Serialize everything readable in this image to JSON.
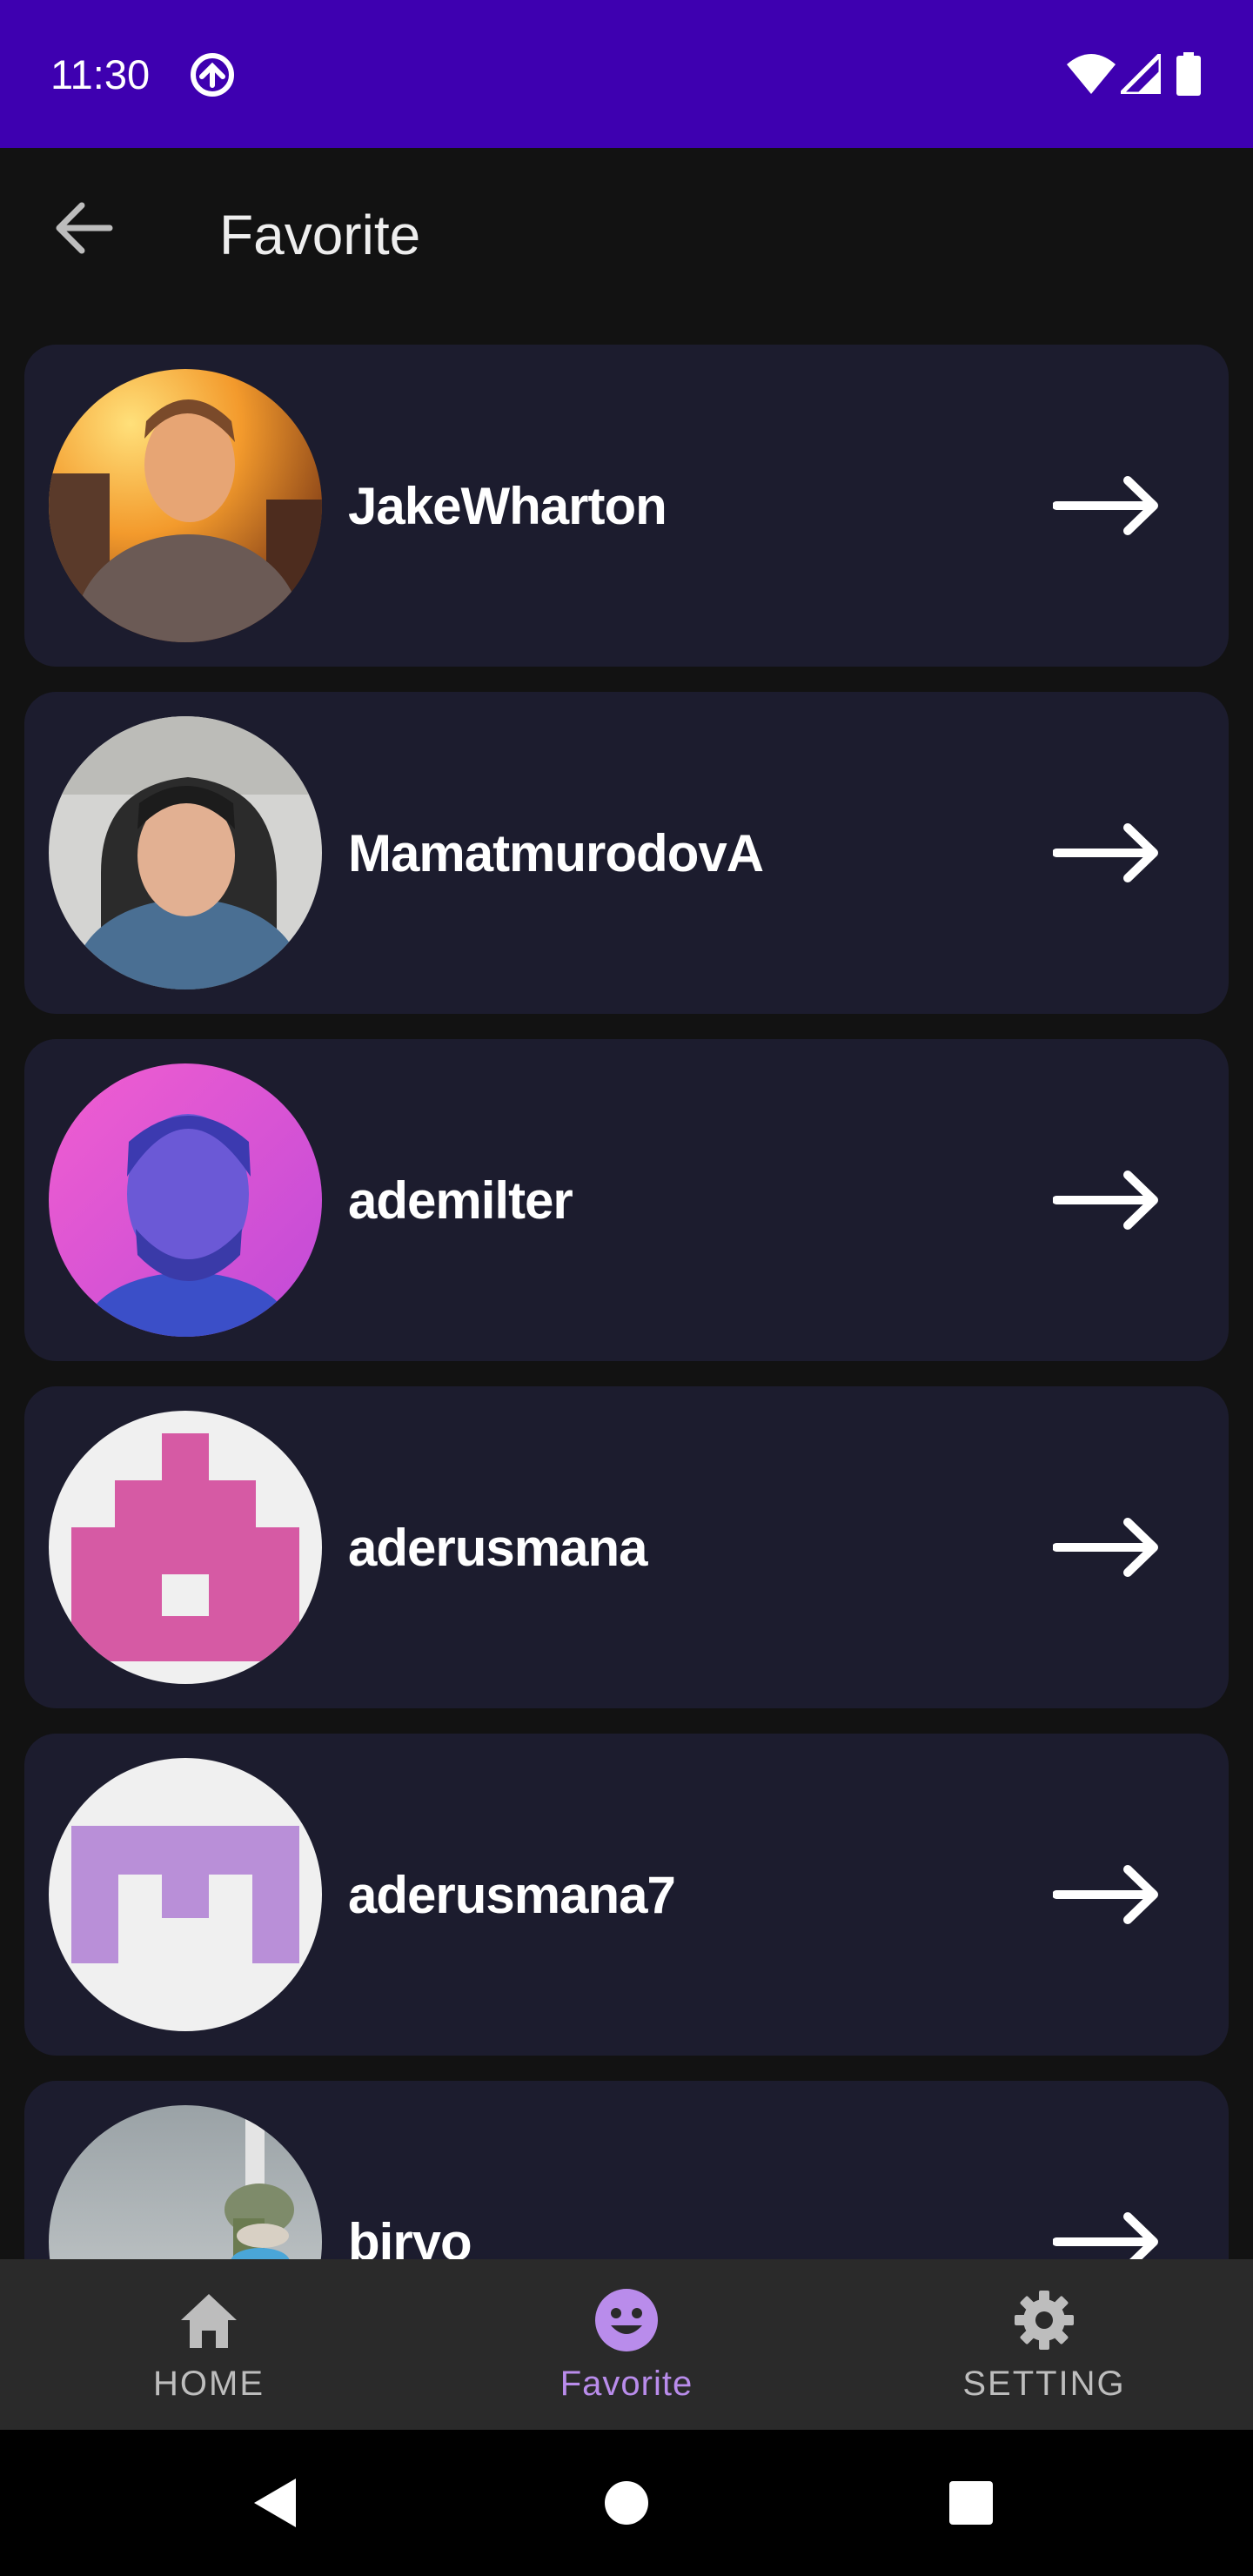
{
  "status_bar": {
    "time": "11:30",
    "icons": [
      "sync-icon",
      "wifi-icon",
      "signal-icon",
      "battery-icon"
    ],
    "background": "#3E00B0"
  },
  "app_bar": {
    "title": "Favorite",
    "back_icon": "arrow-back-icon"
  },
  "favorites": [
    {
      "username": "JakeWharton",
      "avatar": "photo"
    },
    {
      "username": "MamatmurodovA",
      "avatar": "photo"
    },
    {
      "username": "ademilter",
      "avatar": "photo"
    },
    {
      "username": "aderusmana",
      "avatar": "identicon"
    },
    {
      "username": "aderusmana7",
      "avatar": "identicon"
    },
    {
      "username": "biryo",
      "avatar": "photo"
    }
  ],
  "bottom_nav": {
    "items": [
      {
        "label": "HOME",
        "icon": "home-icon",
        "active": false
      },
      {
        "label": "Favorite",
        "icon": "smiley-icon",
        "active": true
      },
      {
        "label": "SETTING",
        "icon": "gear-icon",
        "active": false
      }
    ],
    "active_color": "#B98CEB",
    "inactive_color": "#BDBDBD"
  },
  "system_nav": {
    "buttons": [
      "back-triangle-icon",
      "home-circle-icon",
      "recents-square-icon"
    ]
  },
  "colors": {
    "card_background": "#1C1C2E",
    "page_background": "#121212"
  }
}
